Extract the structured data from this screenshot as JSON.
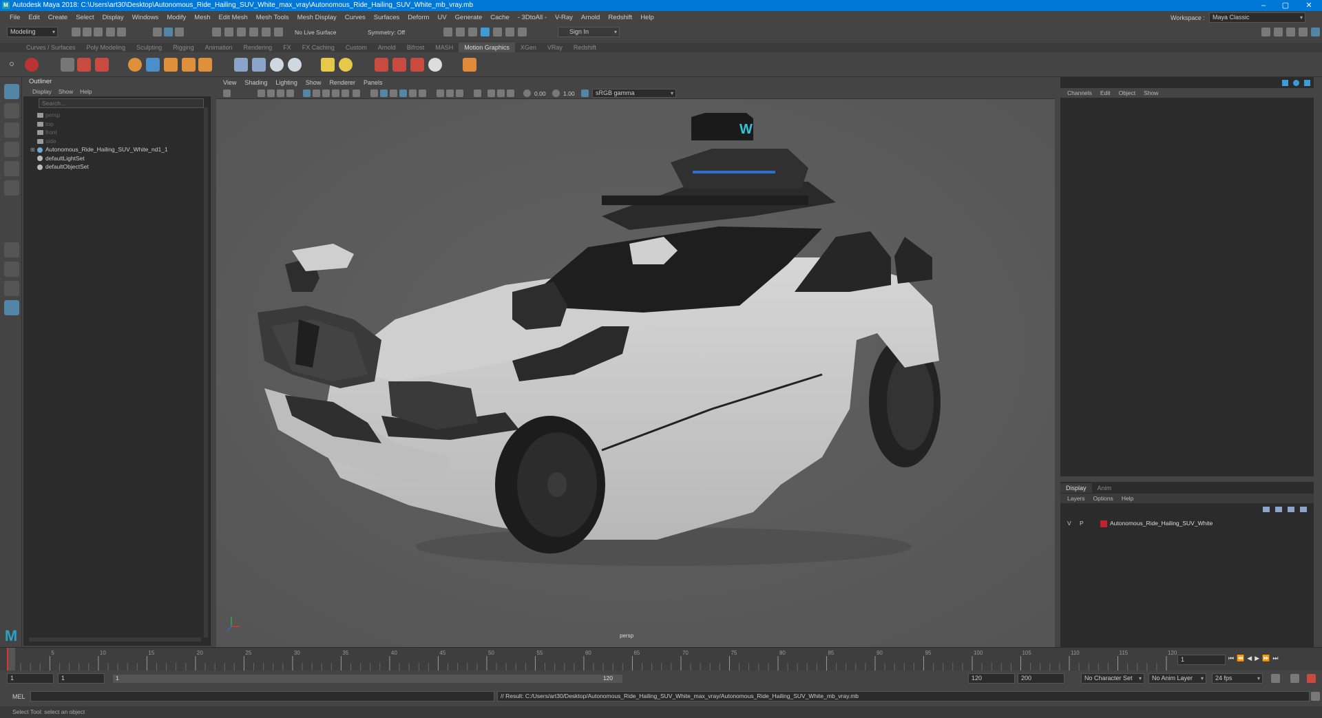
{
  "window": {
    "title": "Autodesk Maya 2018: C:\\Users\\art30\\Desktop\\Autonomous_Ride_Hailing_SUV_White_max_vray\\Autonomous_Ride_Hailing_SUV_White_mb_vray.mb",
    "app_icon": "M",
    "minimize": "–",
    "maximize": "▢",
    "close": "✕"
  },
  "menubar": {
    "items": [
      "File",
      "Edit",
      "Create",
      "Select",
      "Display",
      "Windows",
      "Modify",
      "Mesh",
      "Edit Mesh",
      "Mesh Tools",
      "Mesh Display",
      "Curves",
      "Surfaces",
      "Deform",
      "UV",
      "Generate",
      "Cache",
      "- 3DtoAll -",
      "V-Ray",
      "Arnold",
      "Redshift",
      "Help"
    ],
    "workspace_label": "Workspace :",
    "workspace_value": "Maya Classic"
  },
  "statusline": {
    "mode": "Modeling",
    "live_surface": "No Live Surface",
    "symmetry": "Symmetry: Off",
    "sign_in": "Sign In"
  },
  "shelf": {
    "tabs": [
      "Curves / Surfaces",
      "Poly Modeling",
      "Sculpting",
      "Rigging",
      "Animation",
      "Rendering",
      "FX",
      "FX Caching",
      "Custom",
      "Arnold",
      "Bifrost",
      "MASH",
      "Motion Graphics",
      "XGen",
      "VRay",
      "Redshift"
    ],
    "active_tab": "Motion Graphics"
  },
  "outliner": {
    "title": "Outliner",
    "menu": [
      "Display",
      "Show",
      "Help"
    ],
    "search_placeholder": "Search...",
    "items": [
      {
        "label": "persp",
        "dim": true
      },
      {
        "label": "top",
        "dim": true
      },
      {
        "label": "front",
        "dim": true
      },
      {
        "label": "side",
        "dim": true
      },
      {
        "label": "Autonomous_Ride_Hailing_SUV_White_nd1_1",
        "dim": false
      },
      {
        "label": "defaultLightSet",
        "dim": false
      },
      {
        "label": "defaultObjectSet",
        "dim": false
      }
    ]
  },
  "viewport": {
    "menu": [
      "View",
      "Shading",
      "Lighting",
      "Show",
      "Renderer",
      "Panels"
    ],
    "exposure": "0.00",
    "gamma": "1.00",
    "color_space": "sRGB gamma",
    "camera_label": "persp",
    "roof_logo": "W"
  },
  "channelbox": {
    "menu": [
      "Channels",
      "Edit",
      "Object",
      "Show"
    ]
  },
  "layers": {
    "tabs": [
      "Display",
      "Anim"
    ],
    "active_tab": "Display",
    "menu": [
      "Layers",
      "Options",
      "Help"
    ],
    "rows": [
      {
        "v": "V",
        "p": "P",
        "color": "#c0232b",
        "name": "Autonomous_Ride_Hailing_SUV_White"
      }
    ]
  },
  "timeline": {
    "ticks": [
      "1",
      "5",
      "10",
      "15",
      "20",
      "25",
      "30",
      "35",
      "40",
      "45",
      "50",
      "55",
      "60",
      "65",
      "70",
      "75",
      "80",
      "85",
      "90",
      "95",
      "100",
      "105",
      "110",
      "115",
      "120"
    ],
    "current_frame": "1"
  },
  "range": {
    "start": "1",
    "start_inner": "1",
    "slider_start": "1",
    "slider_end": "120",
    "end_inner": "120",
    "end": "200",
    "character_set": "No Character Set",
    "anim_layer": "No Anim Layer",
    "fps": "24 fps"
  },
  "mel": {
    "label": "MEL",
    "result": "// Result: C:/Users/art30/Desktop/Autonomous_Ride_Hailing_SUV_White_max_vray/Autonomous_Ride_Hailing_SUV_White_mb_vray.mb"
  },
  "helpline": {
    "text": "Select Tool: select an object"
  },
  "colors": {
    "titlebar": "#0078d7",
    "panel_bg": "#444444",
    "panel_dark": "#2b2b2b",
    "viewport_bg": "#5a5a5a",
    "selection_blue": "#5285a6",
    "layer_red": "#c0232b"
  }
}
